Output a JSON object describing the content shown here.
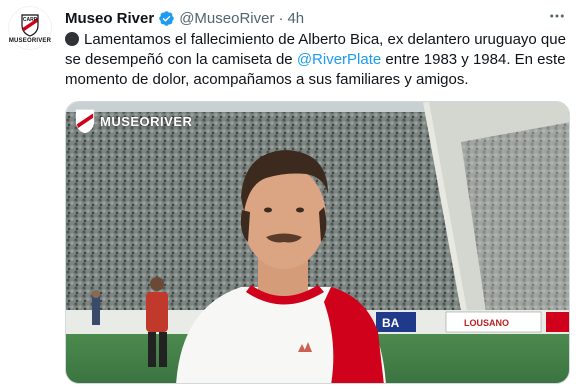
{
  "tweet": {
    "display_name": "Museo River",
    "handle": "@MuseoRiver",
    "separator": "·",
    "time": "4h",
    "avatar_wordmark": "MUSEORIVER",
    "text_part1": "Lamentamos el fallecimiento de Alberto Bica, ex delantero uruguayo que se desempeñó con la camiseta de ",
    "mention": "@RiverPlate",
    "text_part2": " entre 1983 y 1984. En este momento de dolor, acompañamos a sus familiares y amigos.",
    "more_icon": "more-horizontal-icon",
    "verified_icon": "verified-badge-icon"
  },
  "media": {
    "watermark": "MUSEORIVER",
    "signs": [
      "BA",
      "LOUSANO"
    ]
  },
  "colors": {
    "link": "#1d9bf0",
    "verified": "#1d9bf0",
    "secondary_text": "#536471",
    "river_red": "#d0021b"
  }
}
